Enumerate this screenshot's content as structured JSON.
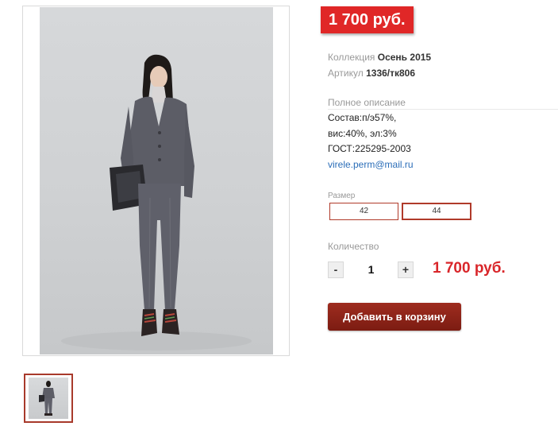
{
  "product": {
    "price_badge": "1 700 руб.",
    "collection_label": "Коллекция",
    "collection_value": "Осень 2015",
    "article_label": "Артикул",
    "article_value": "1336/тк806",
    "description_title": "Полное описание",
    "description_lines": [
      "Состав:п/э57%,",
      "вис:40%, эл:3%",
      "ГОСТ:225295-2003"
    ],
    "email": "virele.perm@mail.ru",
    "size_label": "Размер",
    "sizes": [
      "42",
      "44"
    ],
    "selected_size": "44",
    "quantity_label": "Количество",
    "quantity": "1",
    "minus_label": "-",
    "plus_label": "+",
    "total_price": "1 700 руб.",
    "add_to_cart": "Добавить в корзину"
  },
  "colors": {
    "price_red": "#e02727",
    "cart_button": "#8e2418",
    "size_border": "#b03a2a",
    "link_blue": "#2a6db8"
  }
}
